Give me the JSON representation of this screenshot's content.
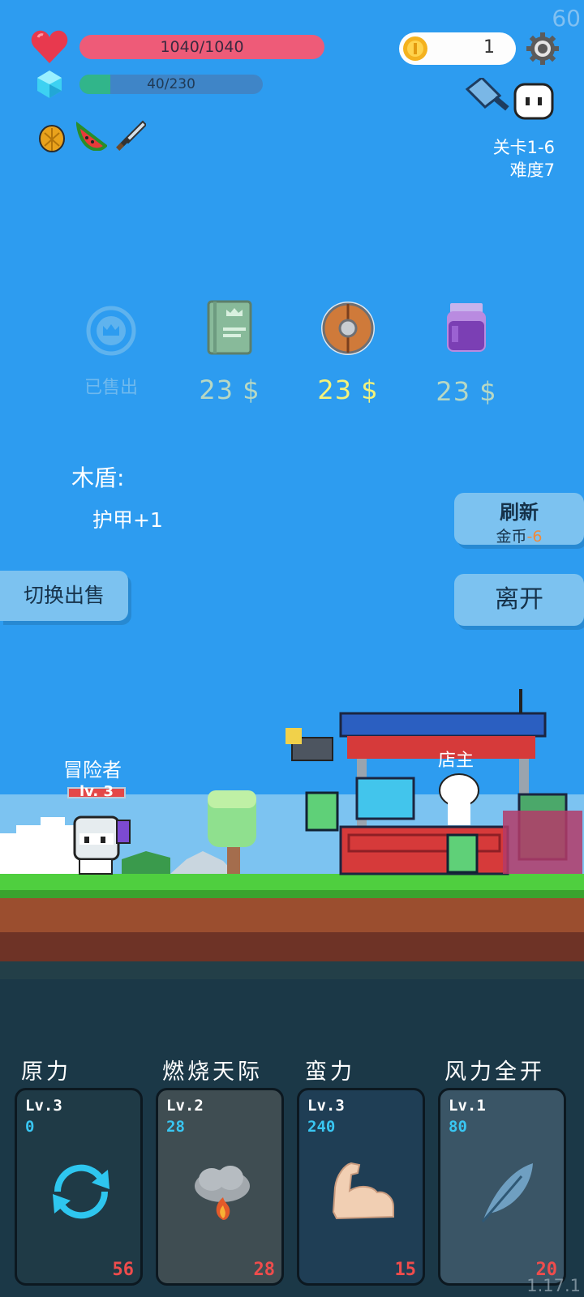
{
  "fps": "60",
  "player": {
    "hp": "1040/1040",
    "mp": "40/230",
    "mp_fraction": 0.17
  },
  "currency": {
    "coins": "1"
  },
  "stage": {
    "level": "关卡1-6",
    "difficulty": "难度7"
  },
  "shop": {
    "items": [
      {
        "label": "已售出",
        "icon": "crown-icon",
        "sold": true
      },
      {
        "label": "23 $",
        "icon": "book-icon",
        "sold": false
      },
      {
        "label": "23 $",
        "icon": "wooden-shield-icon",
        "sold": false,
        "selected": true
      },
      {
        "label": "23 $",
        "icon": "jam-jar-icon",
        "sold": false
      }
    ],
    "selected_name": "木盾:",
    "selected_effect": "护甲+1",
    "refresh_label": "刷新",
    "refresh_cost_prefix": "金币",
    "refresh_cost_value": "-6",
    "leave_label": "离开",
    "switch_label": "切换出售"
  },
  "scene": {
    "adventurer_name": "冒险者",
    "adventurer_level": "lv. 3",
    "shopkeeper_label": "店主"
  },
  "skills": [
    {
      "name": "原力",
      "level": "Lv.3",
      "cost": "0",
      "count": "56",
      "icon": "cycle-arrows-icon"
    },
    {
      "name": "燃烧天际",
      "level": "Lv.2",
      "cost": "28",
      "count": "28",
      "icon": "fire-cloud-icon"
    },
    {
      "name": "蛮力",
      "level": "Lv.3",
      "cost": "240",
      "count": "15",
      "icon": "flexed-arm-icon"
    },
    {
      "name": "风力全开",
      "level": "Lv.1",
      "cost": "80",
      "count": "20",
      "icon": "feather-icon"
    }
  ],
  "version": "1.17.1",
  "colors": {
    "sky": "#2d9cf0",
    "hp": "#ee5b78",
    "mp": "#31b58a",
    "price_active": "#f4f27a",
    "price_dim": "#b7d8c4"
  }
}
